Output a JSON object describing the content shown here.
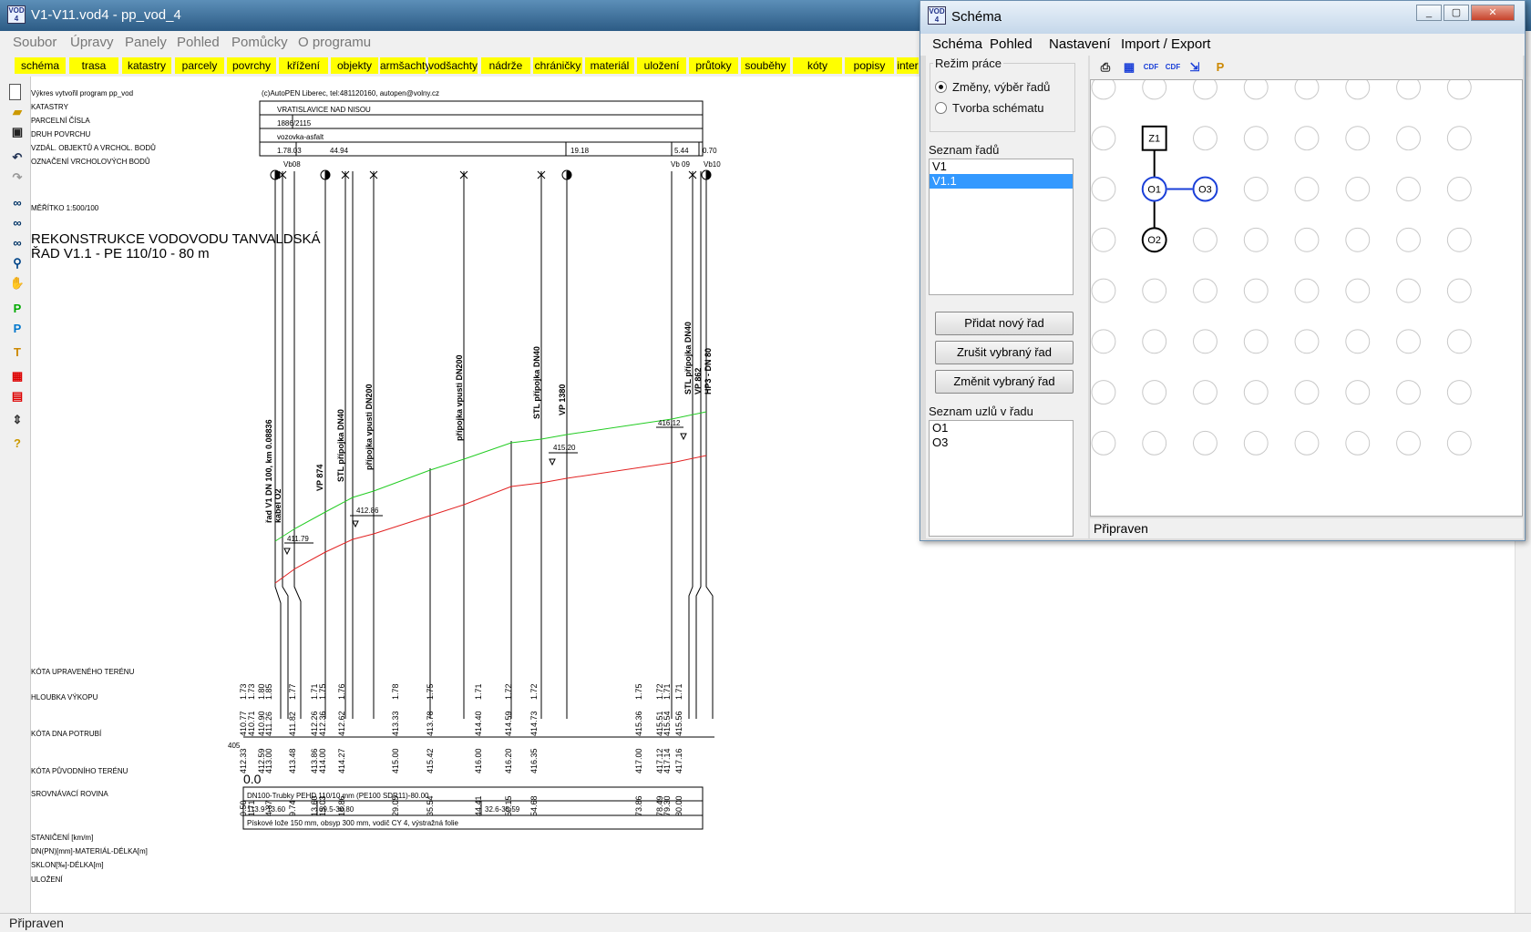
{
  "main_window": {
    "title": "V1-V11.vod4 - pp_vod_4",
    "icon_label": "VOD 4",
    "menu": [
      "Soubor",
      "Úpravy",
      "Panely",
      "Pohled",
      "Pomůcky",
      "O programu"
    ],
    "tabs": [
      "schéma",
      "trasa",
      "katastry",
      "parcely",
      "povrchy",
      "křížení",
      "objekty",
      "armšachty",
      "vodšachty",
      "nádrže",
      "chráničky",
      "materiál",
      "uložení",
      "průtoky",
      "souběhy",
      "kóty",
      "popisy",
      "inter"
    ],
    "status": "Připraven",
    "left_tools": [
      "new-doc-icon",
      "open-folder-icon",
      "save-icon",
      "undo-icon",
      "redo-icon",
      "glasses-icon",
      "glasses-icon",
      "glasses-icon",
      "zoom-icon",
      "pan-icon",
      "p-green-icon",
      "p-blue-icon",
      "text-t-icon",
      "red-grid-icon",
      "red-window-icon",
      "layers-icon",
      "help-icon"
    ]
  },
  "drawing": {
    "credit": "Výkres vytvořil program pp_vod",
    "company": "(c)AutoPEN Liberec, tel:481120160, autopen@volny.cz",
    "row_labels": {
      "katastry": "KATASTRY",
      "parcelni": "PARCELNÍ ČÍSLA",
      "druh": "DRUH POVRCHU",
      "vzdal": "VZDÁL. OBJEKTŮ A VRCHOL. BODŮ",
      "oznaceni": "OZNAČENÍ VRCHOLOVÝCH BODŮ",
      "meritko": "MĚŘÍTKO 1:500/100",
      "kota_upr": "KÓTA UPRAVENÉHO TERÉNU",
      "hloubka": "HLOUBKA VÝKOPU",
      "kota_dna": "KÓTA DNA POTRUBÍ",
      "kota_puv": "KÓTA PŮVODNÍHO TERÉNU",
      "srovnavaci": "SROVNÁVACÍ ROVINA",
      "staniceni": "STANIČENÍ [km/m]",
      "dn": "DN(PN)[mm]-MATERIÁL-DÉLKA[m]",
      "sklon": "SKLON[‰]-DÉLKA[m]",
      "ulozeni": "ULOŽENÍ"
    },
    "katastr_value": "VRATISLAVICE NAD NISOU",
    "parcel_value": "1886/2115",
    "surface_value": "vozovka-asfalt",
    "distances": [
      "1.78.03",
      "44.94",
      "19.18",
      "5.44",
      "0.70"
    ],
    "vertex_labels": [
      "Vb08",
      "Vb 09",
      "Vb10"
    ],
    "title_line1": "REKONSTRUKCE VODOVODU TANVALDSKÁ",
    "title_line2": "ŘAD V1.1 - PE 110/10 - 80 m",
    "datum": "405",
    "stationing_start": "0.0",
    "dn_text": "DN100-Trubky PEHD 110/10 mm (PE100 SDR11)-80.00",
    "sklon_values": [
      "113.9-13.60",
      "69.5-30.80",
      "32.6-35.59"
    ],
    "ulozeni_text": "Pískové lože 150 mm, obsyp 300 mm, vodič CY 4, výstražná folie",
    "annotations": [
      "řad V1 DN 100, km 0.08836",
      "kabel O2",
      "VP 874",
      "STL přípojka DN40",
      "přípojka vpusti DN200",
      "přípojka vpusti DN200",
      "STL přípojka DN40",
      "VP 1380",
      "STL přípojka DN40",
      "VP 862",
      "HP3 - DN 80"
    ],
    "level_labels": [
      "411.79",
      "412.86",
      "415.20",
      "416.12"
    ],
    "columns": [
      {
        "hl": "1.73",
        "dno": "410.77",
        "puv": "412.33",
        "st": "0.50"
      },
      {
        "hl": "1.73",
        "dno": "410.71",
        "puv": "",
        "st": "1.71"
      },
      {
        "hl": "1.80",
        "dno": "410.90",
        "puv": "412.59",
        "st": ""
      },
      {
        "hl": "1.85",
        "dno": "411.26",
        "puv": "413.00",
        "st": "4.87"
      },
      {
        "hl": "1.77",
        "dno": "411.82",
        "puv": "413.48",
        "st": "9.74"
      },
      {
        "hl": "1.71",
        "dno": "412.26",
        "puv": "413.86",
        "st": "13.60"
      },
      {
        "hl": "1.75",
        "dno": "412.36",
        "puv": "414.00",
        "st": "15.03"
      },
      {
        "hl": "1.76",
        "dno": "412.62",
        "puv": "414.27",
        "st": "18.86"
      },
      {
        "hl": "1.78",
        "dno": "413.33",
        "puv": "415.00",
        "st": "29.05"
      },
      {
        "hl": "1.75",
        "dno": "413.78",
        "puv": "415.42",
        "st": "35.54"
      },
      {
        "hl": "1.71",
        "dno": "414.40",
        "puv": "416.00",
        "st": "44.41"
      },
      {
        "hl": "1.72",
        "dno": "414.59",
        "puv": "416.20",
        "st": "50.15"
      },
      {
        "hl": "1.72",
        "dno": "414.73",
        "puv": "416.35",
        "st": "54.68"
      },
      {
        "hl": "1.75",
        "dno": "415.36",
        "puv": "417.00",
        "st": "73.86"
      },
      {
        "hl": "1.72",
        "dno": "415.51",
        "puv": "417.12",
        "st": "78.49"
      },
      {
        "hl": "1.71",
        "dno": "415.54",
        "puv": "417.14",
        "st": "79.30"
      },
      {
        "hl": "1.71",
        "dno": "415.56",
        "puv": "417.16",
        "st": "80.00"
      }
    ]
  },
  "schema_window": {
    "title": "Schéma",
    "menu": [
      "Schéma",
      "Pohled",
      "Nastavení",
      "Import / Export"
    ],
    "mode_group": "Režim práce",
    "mode_options": [
      "Změny, výběr řadů",
      "Tvorba schématu"
    ],
    "rows_label": "Seznam řadů",
    "rows": [
      "V1",
      "V1.1"
    ],
    "selected_row": "V1.1",
    "buttons": [
      "Přidat nový řad",
      "Zrušit vybraný řad",
      "Změnit vybraný řad"
    ],
    "nodes_label": "Seznam uzlů v řadu",
    "nodes": [
      "O1",
      "O3"
    ],
    "toolbar": [
      "printer-icon",
      "grid-icon",
      "cdf-export-icon",
      "cdf-import-icon",
      "export-icon",
      "p-icon"
    ],
    "graph_nodes": [
      "Z1",
      "O1",
      "O3",
      "O2"
    ],
    "status": "Připraven",
    "window_buttons": [
      "minimize-icon",
      "maximize-icon",
      "close-icon"
    ]
  },
  "colors": {
    "tab": "#ffff00",
    "selection": "#3399ff",
    "terrain_new": "#22cc22",
    "terrain_orig": "#e22222",
    "node_blue": "#1a3fd8"
  }
}
